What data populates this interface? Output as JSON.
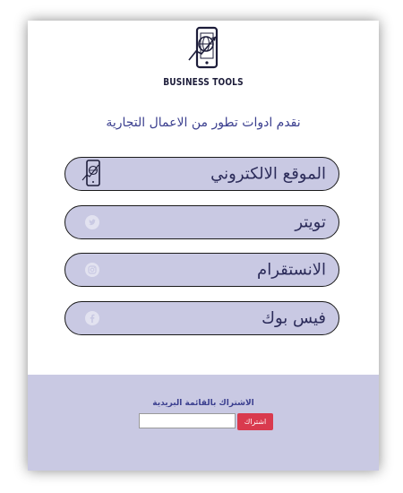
{
  "brand": {
    "logo_text": "BUSINESS TOOLS",
    "icon": "phone-globe-logo-icon",
    "dark_color": "#1d1d3a"
  },
  "tagline": "نقدم ادوات تطور من الاعمال التجارية",
  "links": [
    {
      "label": "الموقع الالكتروني",
      "icon": "phone-globe-icon"
    },
    {
      "label": "تويتر",
      "icon": "twitter-icon"
    },
    {
      "label": "الانستقرام",
      "icon": "instagram-icon"
    },
    {
      "label": "فيس بوك",
      "icon": "facebook-icon"
    }
  ],
  "newsletter": {
    "title": "الاشتراك بالقائمة البريدية",
    "email_value": "",
    "button_label": "اشتراك"
  },
  "colors": {
    "accent_text": "#3b3f8f",
    "pill_background": "#c9c9e3",
    "pill_border": "#1a1a1a",
    "footer_background": "#c9c9e3",
    "button_red": "#d93a4e"
  }
}
